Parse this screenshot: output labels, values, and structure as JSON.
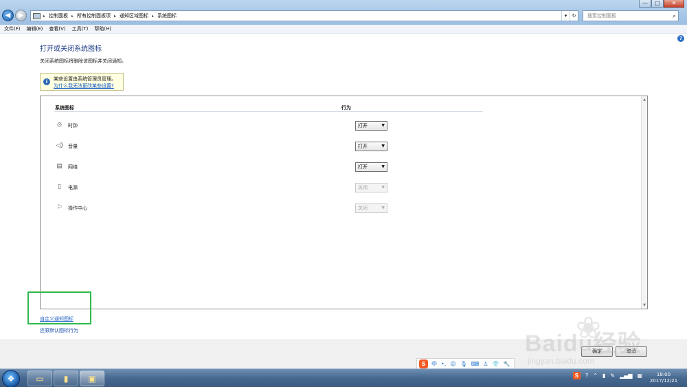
{
  "window": {
    "minimize_glyph": "—",
    "maximize_glyph": "□",
    "close_glyph": "✕"
  },
  "address": {
    "crumbs": [
      "控制面板",
      "所有控制面板项",
      "通知区域图标",
      "系统图标"
    ],
    "separator": "▸",
    "dropdown_glyph": "▾",
    "refresh_glyph": "↻"
  },
  "search": {
    "placeholder": "搜索控制面板"
  },
  "menu": [
    "文件(F)",
    "编辑(E)",
    "查看(V)",
    "工具(T)",
    "帮助(H)"
  ],
  "page": {
    "title": "打开或关闭系统图标",
    "description": "关闭系统图标将删除该图标并关闭通知。"
  },
  "info": {
    "text": "某些设置由系统管理员管理。",
    "link": "为什么我无法更改某些设置?"
  },
  "table": {
    "col_icon": "系统图标",
    "col_behavior": "行为",
    "rows": [
      {
        "label": "时钟",
        "icon": "clock-icon",
        "value": "打开",
        "disabled": false
      },
      {
        "label": "音量",
        "icon": "volume-icon",
        "value": "打开",
        "disabled": false
      },
      {
        "label": "网络",
        "icon": "network-icon",
        "value": "打开",
        "disabled": false
      },
      {
        "label": "电源",
        "icon": "power-icon",
        "value": "关闭",
        "disabled": true
      },
      {
        "label": "操作中心",
        "icon": "flag-icon",
        "value": "关闭",
        "disabled": true
      }
    ]
  },
  "links": {
    "customize": "自定义通知图标",
    "restore": "还原默认图标行为"
  },
  "buttons": {
    "ok": "确定",
    "cancel": "取消"
  },
  "ime": {
    "logo": "S",
    "lang": "中"
  },
  "taskbar": {
    "clock_time": "18:00",
    "clock_date": "2017/12/21"
  },
  "watermark": {
    "brand": "Baidu经验",
    "url": "jingyan.baidu.com"
  },
  "colors": {
    "highlight_box": "#2fb84a",
    "link": "#2a6ac7",
    "title": "#1e3c87"
  }
}
